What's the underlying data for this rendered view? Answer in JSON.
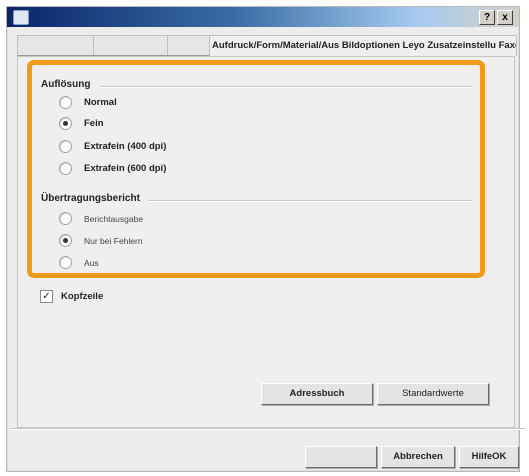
{
  "window": {
    "title_buttons": {
      "help": "?",
      "close": "x"
    }
  },
  "tabs": [
    {
      "label": "",
      "state": "faded"
    },
    {
      "label": "",
      "state": "faded"
    },
    {
      "label": "",
      "state": "faded"
    },
    {
      "label": "Aufdruck/Form/Material/Aus Bildoptionen Leyo Zusatzeinstellu Faxe",
      "state": "active"
    }
  ],
  "resolution": {
    "title": "Auflösung",
    "options": [
      {
        "label": "Normal",
        "checked": false
      },
      {
        "label": "Fein",
        "checked": true
      },
      {
        "label": "Extrafein (400 dpi)",
        "checked": false
      },
      {
        "label": "Extrafein (600 dpi)",
        "checked": false
      }
    ]
  },
  "report": {
    "title": "Übertragungsbericht",
    "options": [
      {
        "label": "Berichtausgabe",
        "checked": false
      },
      {
        "label": "Nur bei Fehlern",
        "checked": true
      },
      {
        "label": "Aus",
        "checked": false
      }
    ]
  },
  "header_checkbox": {
    "label": "Kopfzeile",
    "checked": true,
    "mark": "✓"
  },
  "buttons": {
    "address_book": "Adressbuch",
    "defaults": "Standardwerte",
    "ok_disabled": "",
    "cancel": "Abbrechen",
    "help_ok": "HilfeOK"
  },
  "colors": {
    "highlight": "#f29a1a",
    "title_gradient_start": "#0a246a"
  }
}
